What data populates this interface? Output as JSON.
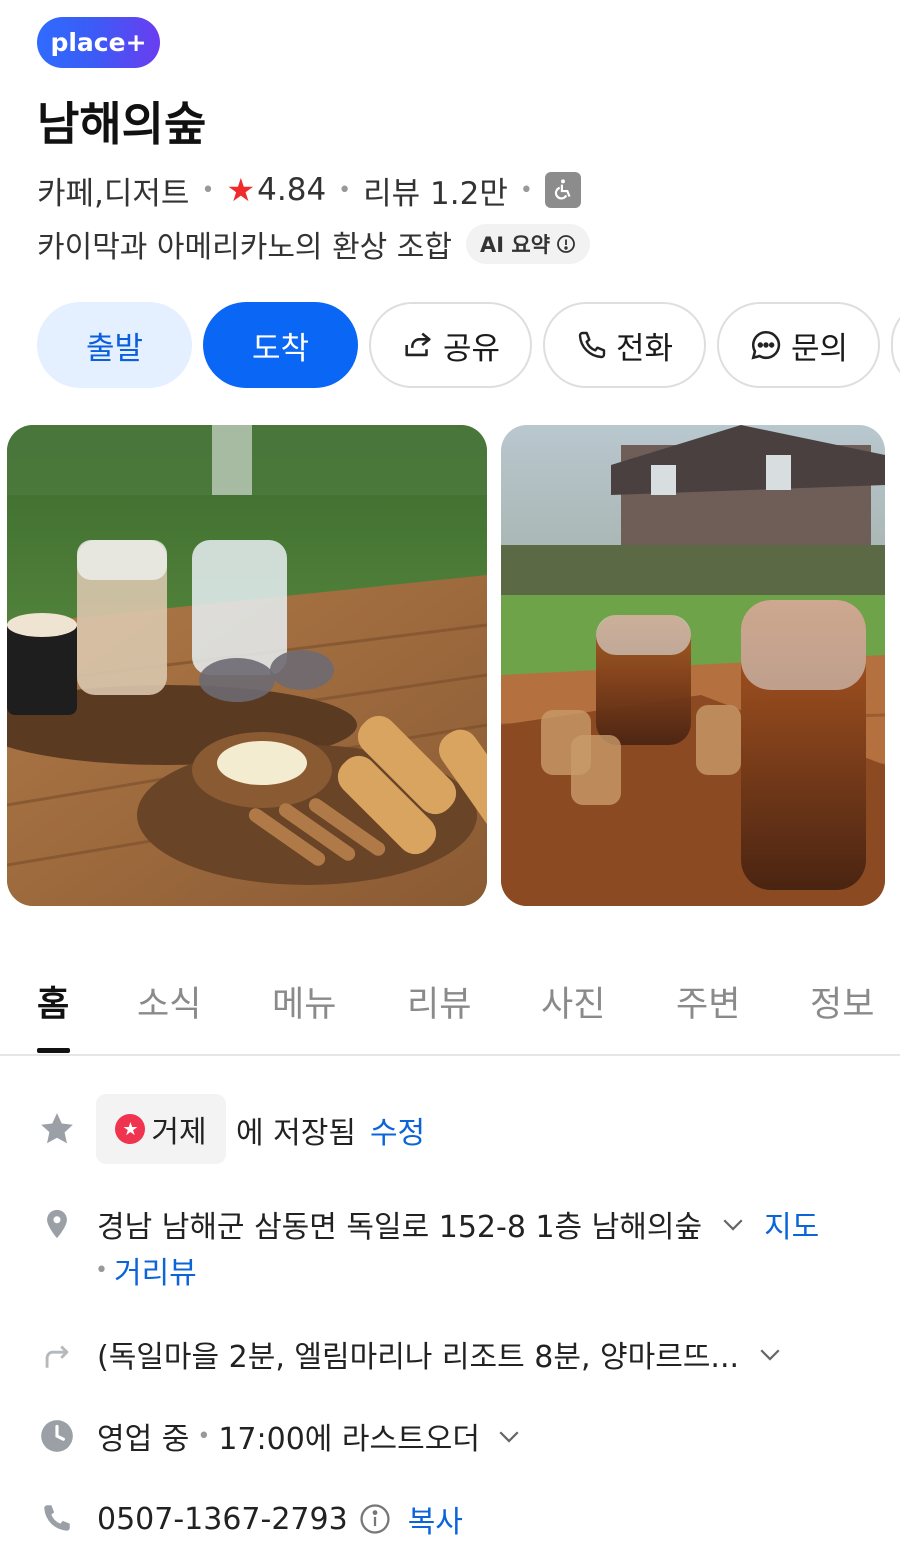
{
  "header": {
    "badge": "place+",
    "title": "남해의숲",
    "category": "카페,디저트",
    "rating": "4.84",
    "review_label": "리뷰 1.2만",
    "summary": "카이막과 아메리카노의 환상 조합",
    "ai_chip": "AI 요약"
  },
  "actions": {
    "depart": "출발",
    "arrive": "도착",
    "share": "공유",
    "call": "전화",
    "ask": "문의"
  },
  "tabs": [
    "홈",
    "소식",
    "메뉴",
    "리뷰",
    "사진",
    "주변",
    "정보"
  ],
  "info": {
    "saved_chip": "거제",
    "saved_text": "에 저장됨",
    "saved_edit": "수정",
    "address": "경남 남해군 삼동면 독일로 152-8 1층 남해의숲",
    "map_link": "지도",
    "streetview_link": "거리뷰",
    "directions": "(독일마을 2분, 엘림마리나 리조트 8분, 양마르뜨...",
    "status": "영업 중",
    "last_order": "17:00에 라스트오더",
    "phone": "0507-1367-2793",
    "copy_link": "복사"
  },
  "colors": {
    "accent_blue": "#0a66f5",
    "link_blue": "#0b64d8",
    "star_red": "#ef2b2b"
  }
}
